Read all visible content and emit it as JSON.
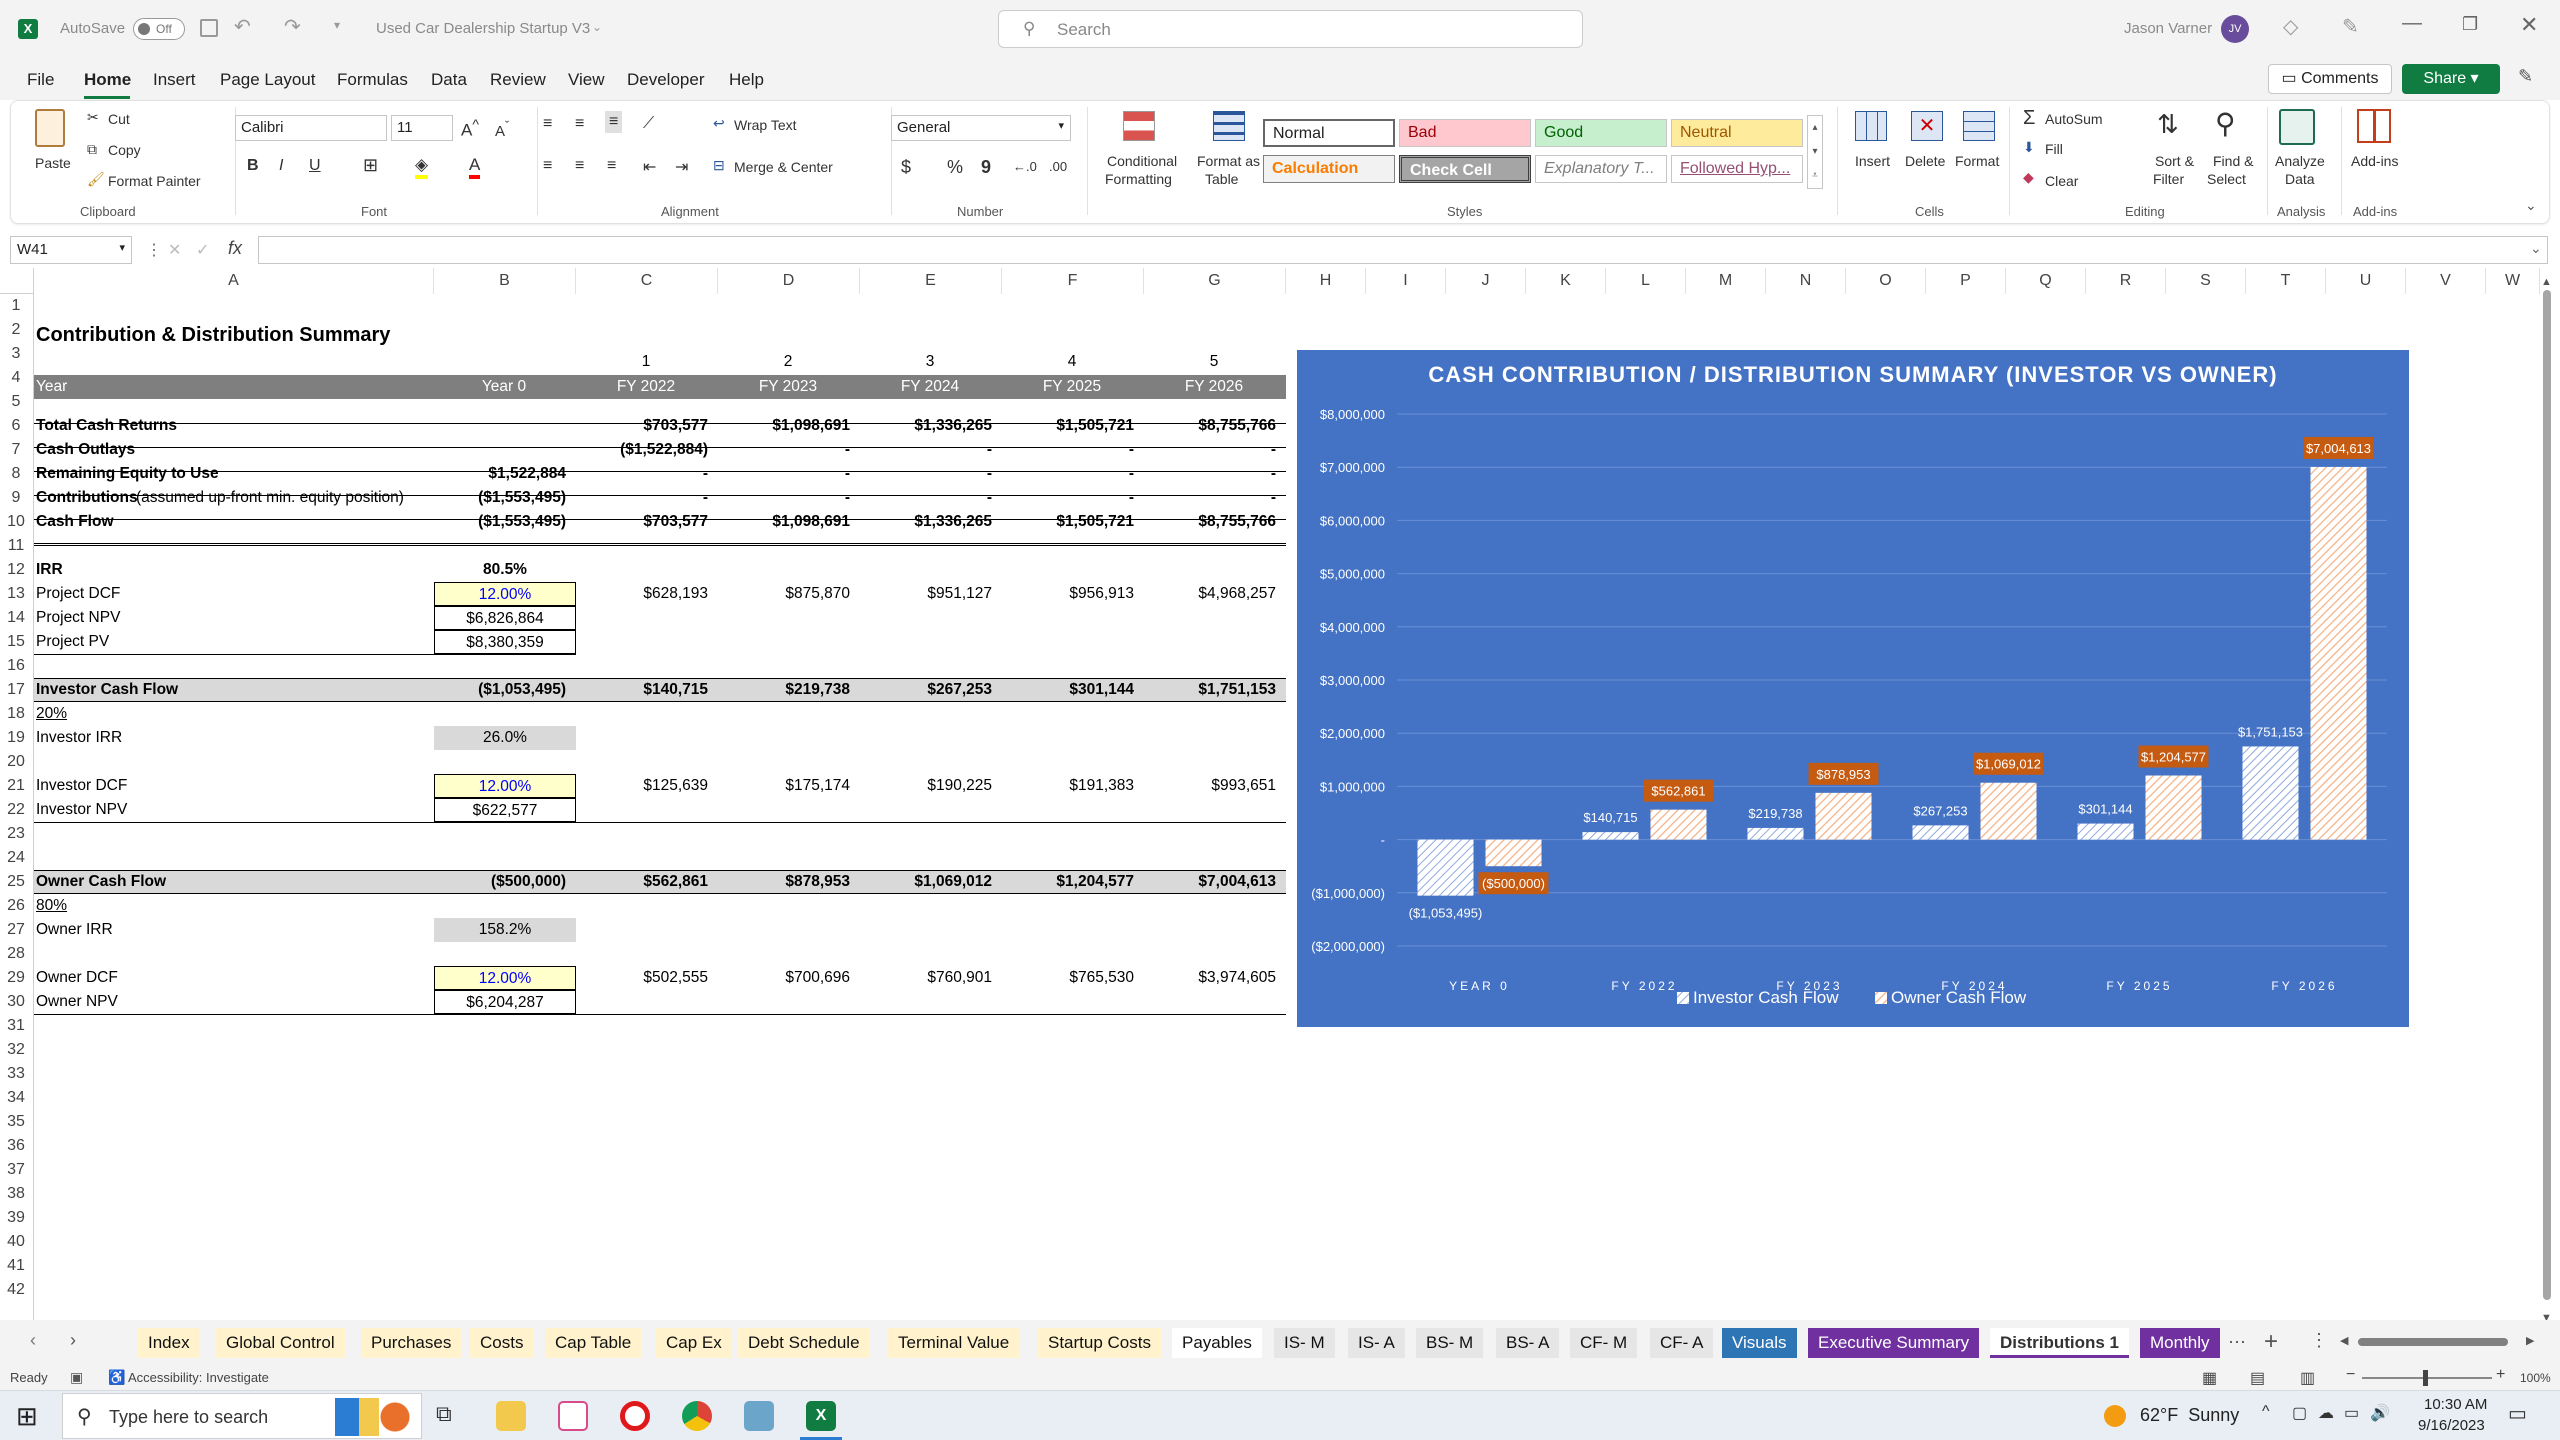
{
  "titlebar": {
    "autosave_label": "AutoSave",
    "autosave_state": "Off",
    "filename": "Used Car Dealership Startup V3",
    "search_placeholder": "Search",
    "user_name": "Jason Varner",
    "user_initials": "JV"
  },
  "menu": {
    "items": [
      "File",
      "Home",
      "Insert",
      "Page Layout",
      "Formulas",
      "Data",
      "Review",
      "View",
      "Developer",
      "Help"
    ],
    "active": "Home",
    "comments": "Comments",
    "share": "Share"
  },
  "ribbon": {
    "clipboard": {
      "paste": "Paste",
      "cut": "Cut",
      "copy": "Copy",
      "format_painter": "Format Painter",
      "label": "Clipboard"
    },
    "font": {
      "name": "Calibri",
      "size": "11",
      "label": "Font"
    },
    "alignment": {
      "wrap": "Wrap Text",
      "merge": "Merge & Center",
      "label": "Alignment"
    },
    "number": {
      "format": "General",
      "label": "Number"
    },
    "styles": {
      "cond1": "Conditional",
      "cond2": "Formatting",
      "fat1": "Format as",
      "fat2": "Table",
      "label": "Styles",
      "boxes": [
        "Normal",
        "Bad",
        "Good",
        "Neutral",
        "Calculation",
        "Check Cell",
        "Explanatory T...",
        "Followed Hyp..."
      ]
    },
    "cells": {
      "insert": "Insert",
      "delete": "Delete",
      "format": "Format",
      "label": "Cells"
    },
    "editing": {
      "autosum": "AutoSum",
      "fill": "Fill",
      "clear": "Clear",
      "sort1": "Sort &",
      "sort2": "Filter",
      "find1": "Find &",
      "find2": "Select",
      "label": "Editing"
    },
    "analysis": {
      "analyze1": "Analyze",
      "analyze2": "Data",
      "label": "Analysis"
    },
    "addins": {
      "addins": "Add-ins",
      "label": "Add-ins"
    }
  },
  "formula_bar": {
    "name_box": "W41",
    "fx": "fx",
    "formula": ""
  },
  "columns": [
    "A",
    "B",
    "C",
    "D",
    "E",
    "F",
    "G",
    "H",
    "I",
    "J",
    "K",
    "L",
    "M",
    "N",
    "O",
    "P",
    "Q",
    "R",
    "S",
    "T",
    "U",
    "V",
    "W"
  ],
  "rows": [
    "1",
    "2",
    "3",
    "4",
    "5",
    "6",
    "7",
    "8",
    "9",
    "10",
    "11",
    "12",
    "13",
    "14",
    "15",
    "16",
    "17",
    "18",
    "19",
    "20",
    "21",
    "22",
    "23",
    "24",
    "25",
    "26",
    "27",
    "28",
    "29",
    "30",
    "31",
    "32",
    "33",
    "34",
    "35",
    "36",
    "37",
    "38",
    "39",
    "40",
    "41",
    "42"
  ],
  "sheet": {
    "title": "Contribution & Distribution Summary",
    "period_nums": [
      "1",
      "2",
      "3",
      "4",
      "5"
    ],
    "header": {
      "year": "Year",
      "cols": [
        "Year 0",
        "FY 2022",
        "FY 2023",
        "FY 2024",
        "FY 2025",
        "FY 2026"
      ]
    },
    "r6": {
      "label": "Total Cash Returns",
      "vals": [
        "",
        "$703,577",
        "$1,098,691",
        "$1,336,265",
        "$1,505,721",
        "$8,755,766"
      ]
    },
    "r7": {
      "label": "Cash Outlays",
      "vals": [
        "",
        "($1,522,884)",
        "-",
        "-",
        "-",
        "-"
      ]
    },
    "r8": {
      "label": "Remaining Equity to Use",
      "vals": [
        "$1,522,884",
        "-",
        "-",
        "-",
        "-",
        "-"
      ]
    },
    "r9": {
      "label": "Contributions",
      "label2": "(assumed up-front min. equity position)",
      "vals": [
        "($1,553,495)",
        "-",
        "-",
        "-",
        "-",
        "-"
      ]
    },
    "r10": {
      "label": "Cash Flow",
      "vals": [
        "($1,553,495)",
        "$703,577",
        "$1,098,691",
        "$1,336,265",
        "$1,505,721",
        "$8,755,766"
      ]
    },
    "r12": {
      "label": "IRR",
      "val": "80.5%"
    },
    "r13": {
      "label": "Project DCF",
      "vals": [
        "12.00%",
        "$628,193",
        "$875,870",
        "$951,127",
        "$956,913",
        "$4,968,257"
      ]
    },
    "r14": {
      "label": "Project NPV",
      "val": "$6,826,864"
    },
    "r15": {
      "label": "Project PV",
      "val": "$8,380,359"
    },
    "r17": {
      "label": "Investor Cash Flow",
      "vals": [
        "($1,053,495)",
        "$140,715",
        "$219,738",
        "$267,253",
        "$301,144",
        "$1,751,153"
      ]
    },
    "r18": {
      "label": "20%"
    },
    "r19": {
      "label": "Investor IRR",
      "val": "26.0%"
    },
    "r21": {
      "label": "Investor DCF",
      "vals": [
        "12.00%",
        "$125,639",
        "$175,174",
        "$190,225",
        "$191,383",
        "$993,651"
      ]
    },
    "r22": {
      "label": "Investor NPV",
      "val": "$622,577"
    },
    "r25": {
      "label": "Owner Cash Flow",
      "vals": [
        "($500,000)",
        "$562,861",
        "$878,953",
        "$1,069,012",
        "$1,204,577",
        "$7,004,613"
      ]
    },
    "r26": {
      "label": "80%"
    },
    "r27": {
      "label": "Owner IRR",
      "val": "158.2%"
    },
    "r29": {
      "label": "Owner DCF",
      "vals": [
        "12.00%",
        "$502,555",
        "$700,696",
        "$760,901",
        "$765,530",
        "$3,974,605"
      ]
    },
    "r30": {
      "label": "Owner NPV",
      "val": "$6,204,287"
    }
  },
  "chart_data": {
    "type": "bar",
    "title": "CASH CONTRIBUTION / DISTRIBUTION SUMMARY (INVESTOR VS OWNER)",
    "categories": [
      "YEAR 0",
      "FY 2022",
      "FY 2023",
      "FY 2024",
      "FY 2025",
      "FY 2026"
    ],
    "series": [
      {
        "name": "Investor Cash Flow",
        "values": [
          -1053495,
          140715,
          219738,
          267253,
          301144,
          1751153
        ],
        "labels": [
          "($1,053,495)",
          "$140,715",
          "$219,738",
          "$267,253",
          "$301,144",
          "$1,751,153"
        ]
      },
      {
        "name": "Owner Cash Flow",
        "values": [
          -500000,
          562861,
          878953,
          1069012,
          1204577,
          7004613
        ],
        "labels": [
          "($500,000)",
          "$562,861",
          "$878,953",
          "$1,069,012",
          "$1,204,577",
          "$7,004,613"
        ]
      }
    ],
    "yticks": [
      "$8,000,000",
      "$7,000,000",
      "$6,000,000",
      "$5,000,000",
      "$4,000,000",
      "$3,000,000",
      "$2,000,000",
      "$1,000,000",
      "-",
      "($1,000,000)",
      "($2,000,000)"
    ],
    "ylim": [
      -2000000,
      8000000
    ],
    "legend_position": "bottom",
    "colors": {
      "background": "#4472c4",
      "investor": "#dbe5f5",
      "owner": "#f4b183",
      "owner_label": "#c55a11"
    }
  },
  "tabs": {
    "items": [
      "Index",
      "Global Control",
      "Purchases",
      "Costs",
      "Cap Table",
      "Cap Ex",
      "Debt Schedule",
      "Terminal Value",
      "Startup Costs",
      "Payables",
      "IS- M",
      "IS- A",
      "BS- M",
      "BS- A",
      "CF- M",
      "CF- A",
      "Visuals",
      "Executive Summary",
      "Distributions 1",
      "Monthly"
    ],
    "active": "Distributions 1"
  },
  "status": {
    "ready": "Ready",
    "accessibility": "Accessibility: Investigate",
    "zoom": "100%"
  },
  "taskbar": {
    "search_placeholder": "Type here to search",
    "weather": "62°F  Sunny",
    "time": "10:30 AM",
    "date": "9/16/2023"
  }
}
